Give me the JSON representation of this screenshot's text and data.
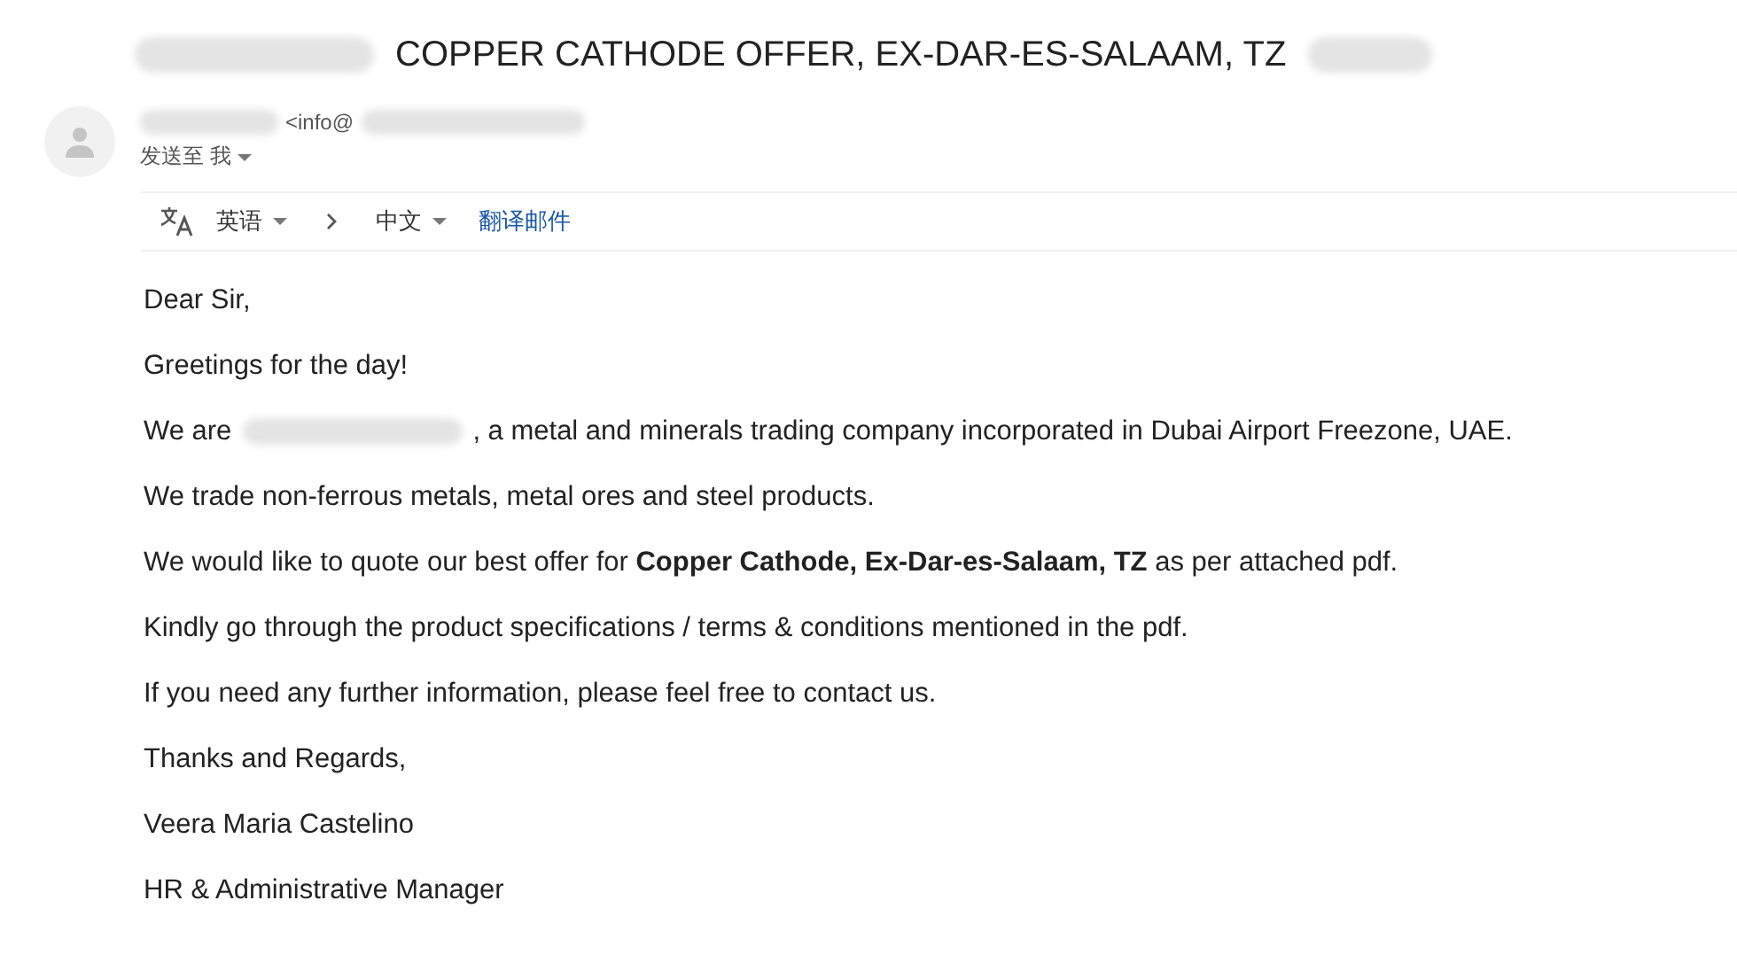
{
  "subject": "COPPER CATHODE OFFER, EX-DAR-ES-SALAAM, TZ",
  "sender": {
    "email_prefix": "<info@",
    "recipient": "发送至 我"
  },
  "translate_bar": {
    "source_language": "英语",
    "target_language": "中文",
    "action": "翻译邮件"
  },
  "body": [
    {
      "kind": "text",
      "text": "Dear Sir,"
    },
    {
      "kind": "text",
      "text": "Greetings for the day!"
    },
    {
      "kind": "redacted",
      "before": "We are",
      "after": ", a metal and minerals trading company incorporated in Dubai Airport Freezone, UAE."
    },
    {
      "kind": "text",
      "text": "We trade non-ferrous metals, metal ores and steel products."
    },
    {
      "kind": "text",
      "text": "We would like to quote our best offer for **Copper Cathode, Ex-Dar-es-Salaam, TZ** as per attached pdf."
    },
    {
      "kind": "text",
      "text": "Kindly go through the product specifications / terms & conditions mentioned in the pdf."
    },
    {
      "kind": "text",
      "text": "If you need any further information, please feel free to contact us."
    },
    {
      "kind": "text",
      "text": "Thanks and Regards,"
    },
    {
      "kind": "text",
      "text": "Veera Maria Castelino"
    },
    {
      "kind": "text",
      "text": "HR & Administrative Manager"
    }
  ]
}
